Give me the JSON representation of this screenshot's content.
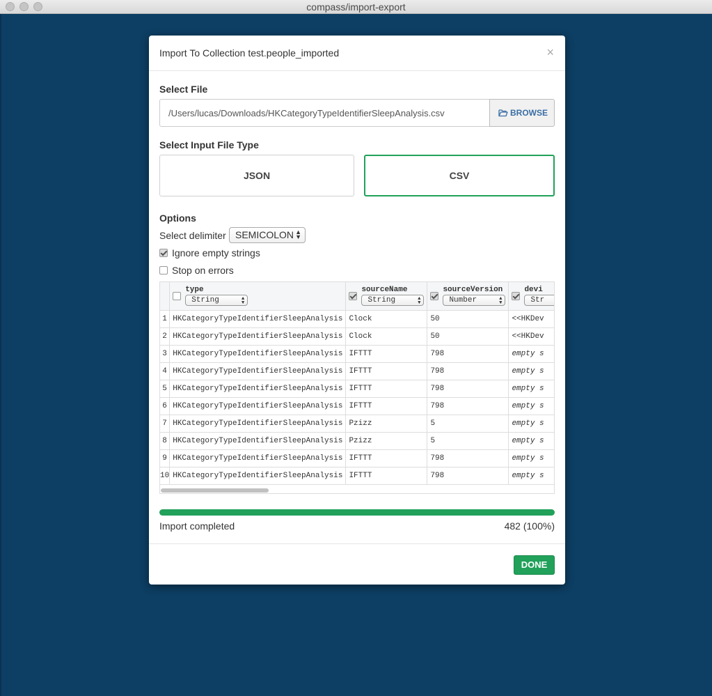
{
  "window": {
    "title": "compass/import-export"
  },
  "modal": {
    "title": "Import To Collection test.people_imported",
    "close_glyph": "×",
    "select_file_label": "Select File",
    "file_path": "/Users/lucas/Downloads/HKCategoryTypeIdentifierSleepAnalysis.csv",
    "browse_label": "BROWSE",
    "file_type_label": "Select Input File Type",
    "file_types": [
      "JSON",
      "CSV"
    ],
    "selected_file_type": "CSV",
    "options_label": "Options",
    "delimiter_label": "Select delimiter",
    "delimiter_value": "SEMICOLON",
    "ignore_empty_label": "Ignore empty strings",
    "ignore_empty_checked": true,
    "stop_on_errors_label": "Stop on errors",
    "stop_on_errors_checked": false,
    "done_label": "DONE"
  },
  "table": {
    "columns": [
      {
        "name": "type",
        "checked": false,
        "type": "String"
      },
      {
        "name": "sourceName",
        "checked": true,
        "type": "String"
      },
      {
        "name": "sourceVersion",
        "checked": true,
        "type": "Number"
      },
      {
        "name": "devi",
        "checked": true,
        "type": "Str"
      }
    ],
    "rows": [
      {
        "n": "1",
        "type": "HKCategoryTypeIdentifierSleepAnalysis",
        "sourceName": "Clock",
        "sourceVersion": "50",
        "device": "<<HKDev"
      },
      {
        "n": "2",
        "type": "HKCategoryTypeIdentifierSleepAnalysis",
        "sourceName": "Clock",
        "sourceVersion": "50",
        "device": "<<HKDev"
      },
      {
        "n": "3",
        "type": "HKCategoryTypeIdentifierSleepAnalysis",
        "sourceName": "IFTTT",
        "sourceVersion": "798",
        "device": "empty s"
      },
      {
        "n": "4",
        "type": "HKCategoryTypeIdentifierSleepAnalysis",
        "sourceName": "IFTTT",
        "sourceVersion": "798",
        "device": "empty s"
      },
      {
        "n": "5",
        "type": "HKCategoryTypeIdentifierSleepAnalysis",
        "sourceName": "IFTTT",
        "sourceVersion": "798",
        "device": "empty s"
      },
      {
        "n": "6",
        "type": "HKCategoryTypeIdentifierSleepAnalysis",
        "sourceName": "IFTTT",
        "sourceVersion": "798",
        "device": "empty s"
      },
      {
        "n": "7",
        "type": "HKCategoryTypeIdentifierSleepAnalysis",
        "sourceName": "Pzizz",
        "sourceVersion": "5",
        "device": "empty s"
      },
      {
        "n": "8",
        "type": "HKCategoryTypeIdentifierSleepAnalysis",
        "sourceName": "Pzizz",
        "sourceVersion": "5",
        "device": "empty s"
      },
      {
        "n": "9",
        "type": "HKCategoryTypeIdentifierSleepAnalysis",
        "sourceName": "IFTTT",
        "sourceVersion": "798",
        "device": "empty s"
      },
      {
        "n": "10",
        "type": "HKCategoryTypeIdentifierSleepAnalysis",
        "sourceName": "IFTTT",
        "sourceVersion": "798",
        "device": "empty s"
      }
    ]
  },
  "progress": {
    "status": "Import completed",
    "count": "482 (100%)",
    "fraction": 1.0
  },
  "colors": {
    "accent": "#21a15a",
    "background": "#0d3e63",
    "link": "#3b6ea5"
  },
  "icons": {
    "browse": "folder-open-icon",
    "close": "close-icon"
  }
}
